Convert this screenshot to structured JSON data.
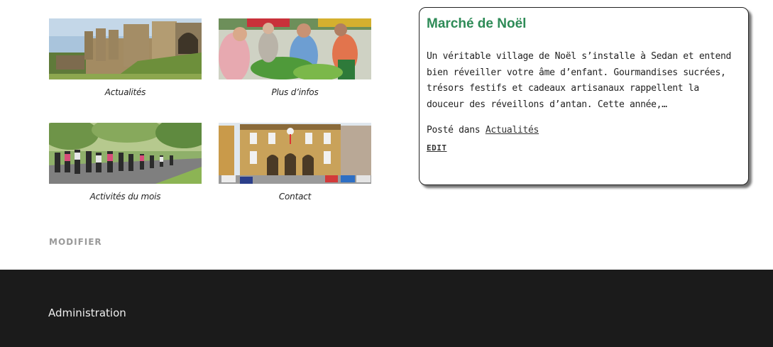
{
  "tiles": [
    {
      "caption": "Actualités",
      "image": "castle-fortress-photo"
    },
    {
      "caption": "Plus d’infos",
      "image": "market-vendors-photo"
    },
    {
      "caption": "Activités du mois",
      "image": "marathon-runners-photo"
    },
    {
      "caption": "Contact",
      "image": "town-hall-photo"
    }
  ],
  "modifier_label": "MODIFIER",
  "post": {
    "title": "Marché de Noël",
    "excerpt": "Un véritable village de Noël s’installe à Sedan et entend bien réveiller votre âme d’enfant. Gourmandises sucrées, trésors festifs et cadeaux artisanaux rappellent la douceur des réveillons d’antan. Cette année,…",
    "posted_in_label": "Posté dans",
    "category": "Actualités",
    "edit_label": "EDIT",
    "title_color": "#2e8b57"
  },
  "footer": {
    "widget_title": "Administration",
    "background": "#1b1b1b"
  }
}
